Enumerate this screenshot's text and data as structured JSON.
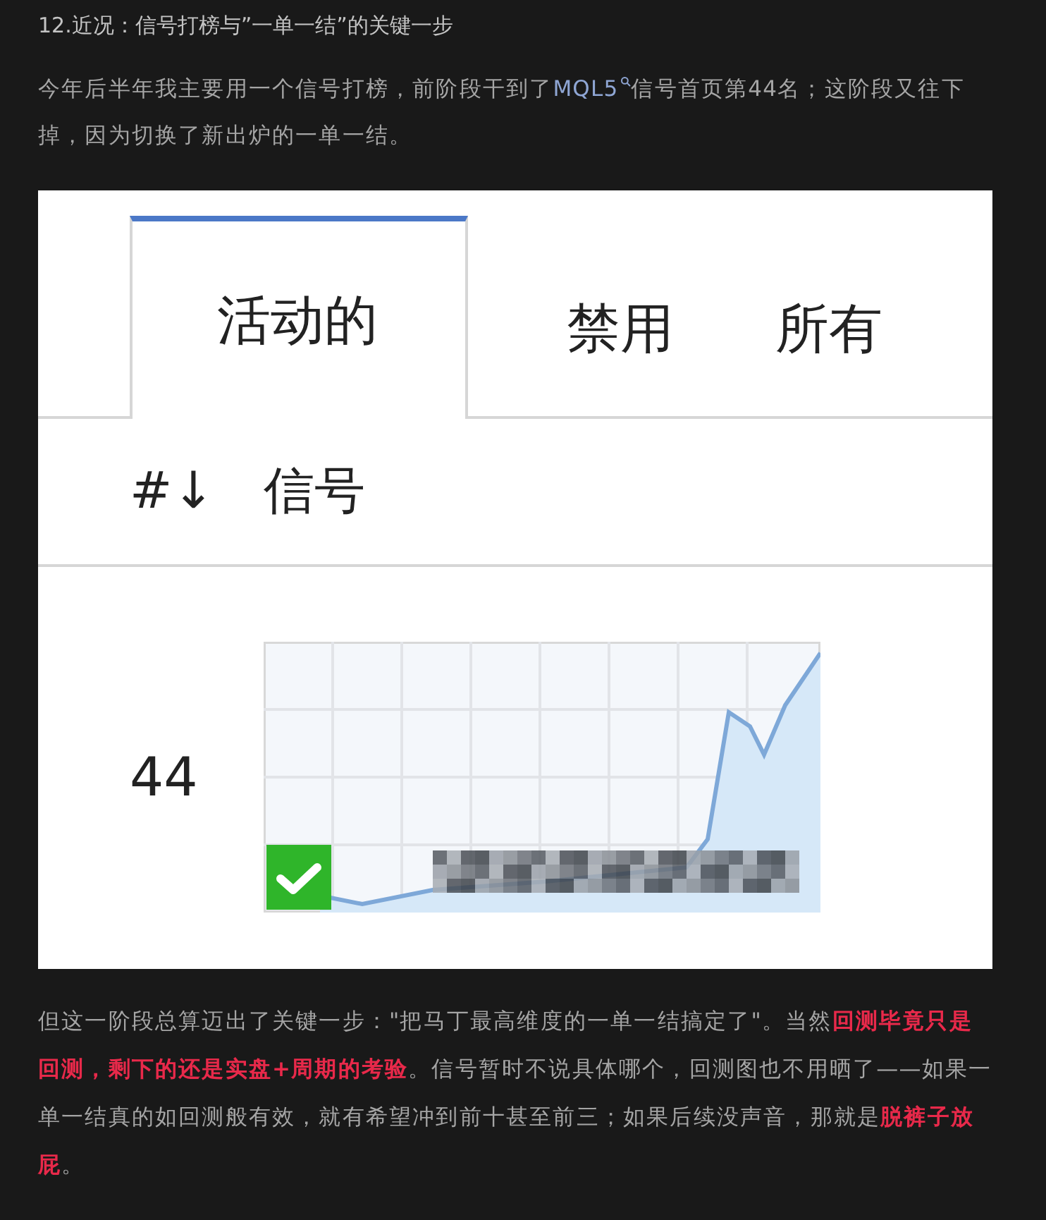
{
  "heading": "12.近况：信号打榜与”一单一结”的关键一步",
  "intro": [
    {
      "kind": "text",
      "text": "今年后半年我主要用一个信号打榜，前阶段干到了"
    },
    {
      "kind": "link",
      "text": "MQL5"
    },
    {
      "kind": "text",
      "text": "信号首页第44名；这阶段又往下掉，因为切换了新出炉的一单一结。"
    }
  ],
  "screenshot": {
    "tabs": [
      {
        "label": "活动的",
        "selected": true
      },
      {
        "label": "禁用",
        "selected": false
      },
      {
        "label": "所有",
        "selected": false
      }
    ],
    "columns": [
      "#↓",
      "信号"
    ],
    "rows": [
      {
        "rank": "44",
        "verified": true
      }
    ]
  },
  "closing": "但这一阶段总算迈出了关键一步：\"把马丁最高维度的一单一结搞定了\"。当然**回测毕竟只是回测，剩下的还是实盘+周期的考验**。信号暂时不说具体哪个，回测图也不用晒了——如果一单一结真的如回测般有效，就有希望冲到前十甚至前三；如果后续没声音，那就是**脱裤子放屁**。"
}
